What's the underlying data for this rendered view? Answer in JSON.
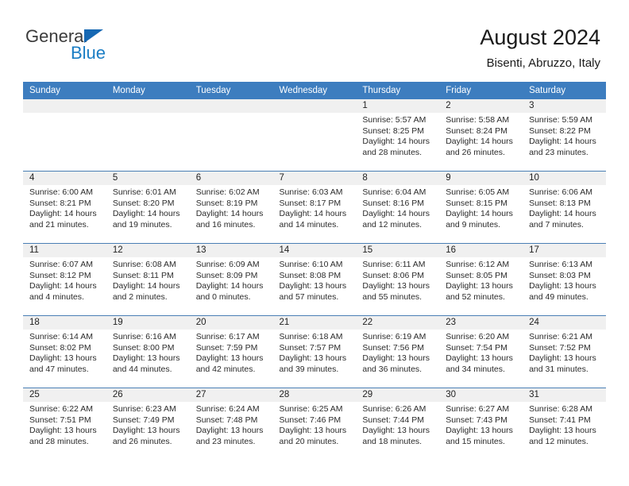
{
  "brand": {
    "name_top": "General",
    "name_bottom": "Blue",
    "accent_color": "#1a7dc4",
    "triangle_color": "#1668b3"
  },
  "header": {
    "title": "August 2024",
    "subtitle": "Bisenti, Abruzzo, Italy"
  },
  "theme": {
    "header_row_bg": "#3d7dbf",
    "header_row_text": "#ffffff",
    "daynum_bar_bg": "#f0f0f0",
    "row_divider": "#4a7fb5",
    "page_bg": "#ffffff"
  },
  "labels": {
    "sunrise_prefix": "Sunrise:",
    "sunset_prefix": "Sunset:",
    "daylight_prefix": "Daylight:"
  },
  "weekdays": [
    "Sunday",
    "Monday",
    "Tuesday",
    "Wednesday",
    "Thursday",
    "Friday",
    "Saturday"
  ],
  "weeks": [
    [
      {
        "day": ""
      },
      {
        "day": ""
      },
      {
        "day": ""
      },
      {
        "day": ""
      },
      {
        "day": "1",
        "sunrise": "Sunrise: 5:57 AM",
        "sunset": "Sunset: 8:25 PM",
        "daylight_line1": "Daylight: 14 hours",
        "daylight_line2": "and 28 minutes."
      },
      {
        "day": "2",
        "sunrise": "Sunrise: 5:58 AM",
        "sunset": "Sunset: 8:24 PM",
        "daylight_line1": "Daylight: 14 hours",
        "daylight_line2": "and 26 minutes."
      },
      {
        "day": "3",
        "sunrise": "Sunrise: 5:59 AM",
        "sunset": "Sunset: 8:22 PM",
        "daylight_line1": "Daylight: 14 hours",
        "daylight_line2": "and 23 minutes."
      }
    ],
    [
      {
        "day": "4",
        "sunrise": "Sunrise: 6:00 AM",
        "sunset": "Sunset: 8:21 PM",
        "daylight_line1": "Daylight: 14 hours",
        "daylight_line2": "and 21 minutes."
      },
      {
        "day": "5",
        "sunrise": "Sunrise: 6:01 AM",
        "sunset": "Sunset: 8:20 PM",
        "daylight_line1": "Daylight: 14 hours",
        "daylight_line2": "and 19 minutes."
      },
      {
        "day": "6",
        "sunrise": "Sunrise: 6:02 AM",
        "sunset": "Sunset: 8:19 PM",
        "daylight_line1": "Daylight: 14 hours",
        "daylight_line2": "and 16 minutes."
      },
      {
        "day": "7",
        "sunrise": "Sunrise: 6:03 AM",
        "sunset": "Sunset: 8:17 PM",
        "daylight_line1": "Daylight: 14 hours",
        "daylight_line2": "and 14 minutes."
      },
      {
        "day": "8",
        "sunrise": "Sunrise: 6:04 AM",
        "sunset": "Sunset: 8:16 PM",
        "daylight_line1": "Daylight: 14 hours",
        "daylight_line2": "and 12 minutes."
      },
      {
        "day": "9",
        "sunrise": "Sunrise: 6:05 AM",
        "sunset": "Sunset: 8:15 PM",
        "daylight_line1": "Daylight: 14 hours",
        "daylight_line2": "and 9 minutes."
      },
      {
        "day": "10",
        "sunrise": "Sunrise: 6:06 AM",
        "sunset": "Sunset: 8:13 PM",
        "daylight_line1": "Daylight: 14 hours",
        "daylight_line2": "and 7 minutes."
      }
    ],
    [
      {
        "day": "11",
        "sunrise": "Sunrise: 6:07 AM",
        "sunset": "Sunset: 8:12 PM",
        "daylight_line1": "Daylight: 14 hours",
        "daylight_line2": "and 4 minutes."
      },
      {
        "day": "12",
        "sunrise": "Sunrise: 6:08 AM",
        "sunset": "Sunset: 8:11 PM",
        "daylight_line1": "Daylight: 14 hours",
        "daylight_line2": "and 2 minutes."
      },
      {
        "day": "13",
        "sunrise": "Sunrise: 6:09 AM",
        "sunset": "Sunset: 8:09 PM",
        "daylight_line1": "Daylight: 14 hours",
        "daylight_line2": "and 0 minutes."
      },
      {
        "day": "14",
        "sunrise": "Sunrise: 6:10 AM",
        "sunset": "Sunset: 8:08 PM",
        "daylight_line1": "Daylight: 13 hours",
        "daylight_line2": "and 57 minutes."
      },
      {
        "day": "15",
        "sunrise": "Sunrise: 6:11 AM",
        "sunset": "Sunset: 8:06 PM",
        "daylight_line1": "Daylight: 13 hours",
        "daylight_line2": "and 55 minutes."
      },
      {
        "day": "16",
        "sunrise": "Sunrise: 6:12 AM",
        "sunset": "Sunset: 8:05 PM",
        "daylight_line1": "Daylight: 13 hours",
        "daylight_line2": "and 52 minutes."
      },
      {
        "day": "17",
        "sunrise": "Sunrise: 6:13 AM",
        "sunset": "Sunset: 8:03 PM",
        "daylight_line1": "Daylight: 13 hours",
        "daylight_line2": "and 49 minutes."
      }
    ],
    [
      {
        "day": "18",
        "sunrise": "Sunrise: 6:14 AM",
        "sunset": "Sunset: 8:02 PM",
        "daylight_line1": "Daylight: 13 hours",
        "daylight_line2": "and 47 minutes."
      },
      {
        "day": "19",
        "sunrise": "Sunrise: 6:16 AM",
        "sunset": "Sunset: 8:00 PM",
        "daylight_line1": "Daylight: 13 hours",
        "daylight_line2": "and 44 minutes."
      },
      {
        "day": "20",
        "sunrise": "Sunrise: 6:17 AM",
        "sunset": "Sunset: 7:59 PM",
        "daylight_line1": "Daylight: 13 hours",
        "daylight_line2": "and 42 minutes."
      },
      {
        "day": "21",
        "sunrise": "Sunrise: 6:18 AM",
        "sunset": "Sunset: 7:57 PM",
        "daylight_line1": "Daylight: 13 hours",
        "daylight_line2": "and 39 minutes."
      },
      {
        "day": "22",
        "sunrise": "Sunrise: 6:19 AM",
        "sunset": "Sunset: 7:56 PM",
        "daylight_line1": "Daylight: 13 hours",
        "daylight_line2": "and 36 minutes."
      },
      {
        "day": "23",
        "sunrise": "Sunrise: 6:20 AM",
        "sunset": "Sunset: 7:54 PM",
        "daylight_line1": "Daylight: 13 hours",
        "daylight_line2": "and 34 minutes."
      },
      {
        "day": "24",
        "sunrise": "Sunrise: 6:21 AM",
        "sunset": "Sunset: 7:52 PM",
        "daylight_line1": "Daylight: 13 hours",
        "daylight_line2": "and 31 minutes."
      }
    ],
    [
      {
        "day": "25",
        "sunrise": "Sunrise: 6:22 AM",
        "sunset": "Sunset: 7:51 PM",
        "daylight_line1": "Daylight: 13 hours",
        "daylight_line2": "and 28 minutes."
      },
      {
        "day": "26",
        "sunrise": "Sunrise: 6:23 AM",
        "sunset": "Sunset: 7:49 PM",
        "daylight_line1": "Daylight: 13 hours",
        "daylight_line2": "and 26 minutes."
      },
      {
        "day": "27",
        "sunrise": "Sunrise: 6:24 AM",
        "sunset": "Sunset: 7:48 PM",
        "daylight_line1": "Daylight: 13 hours",
        "daylight_line2": "and 23 minutes."
      },
      {
        "day": "28",
        "sunrise": "Sunrise: 6:25 AM",
        "sunset": "Sunset: 7:46 PM",
        "daylight_line1": "Daylight: 13 hours",
        "daylight_line2": "and 20 minutes."
      },
      {
        "day": "29",
        "sunrise": "Sunrise: 6:26 AM",
        "sunset": "Sunset: 7:44 PM",
        "daylight_line1": "Daylight: 13 hours",
        "daylight_line2": "and 18 minutes."
      },
      {
        "day": "30",
        "sunrise": "Sunrise: 6:27 AM",
        "sunset": "Sunset: 7:43 PM",
        "daylight_line1": "Daylight: 13 hours",
        "daylight_line2": "and 15 minutes."
      },
      {
        "day": "31",
        "sunrise": "Sunrise: 6:28 AM",
        "sunset": "Sunset: 7:41 PM",
        "daylight_line1": "Daylight: 13 hours",
        "daylight_line2": "and 12 minutes."
      }
    ]
  ]
}
